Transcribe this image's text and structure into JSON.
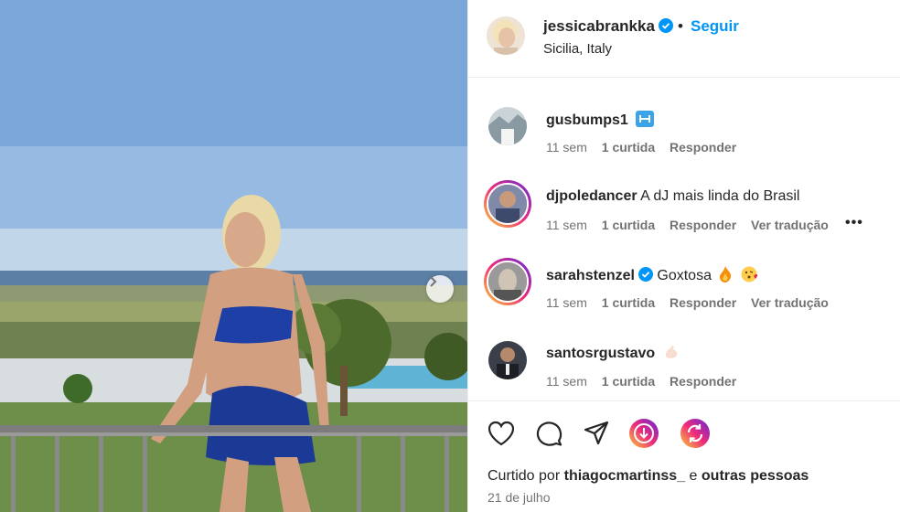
{
  "header": {
    "username": "jessicabrankka",
    "separator": "•",
    "follow_label": "Seguir",
    "location": "Sicilia, Italy"
  },
  "comments": [
    {
      "username": "gusbumps1",
      "text": "",
      "time": "11 sem",
      "likes": "1 curtida",
      "reply": "Responder",
      "translate": "",
      "emoji": "dumbbell-badge",
      "ring": false
    },
    {
      "username": "djpoledancer",
      "text": "A dJ mais linda do Brasil",
      "time": "11 sem",
      "likes": "1 curtida",
      "reply": "Responder",
      "translate": "Ver tradução",
      "ring": true
    },
    {
      "username": "sarahstenzel",
      "text": "Goxtosa",
      "time": "11 sem",
      "likes": "1 curtida",
      "reply": "Responder",
      "translate": "Ver tradução",
      "ring": true,
      "verified": true,
      "emoji": "fire-and-kiss"
    },
    {
      "username": "santosrgustavo",
      "text": "",
      "time": "11 sem",
      "likes": "1 curtida",
      "reply": "Responder",
      "translate": "",
      "emoji": "muscle",
      "ring": false
    }
  ],
  "more_options": "•••",
  "footer": {
    "liked_prefix": "Curtido por",
    "liked_user": "thiagocmartinss_",
    "liked_connector": "e",
    "liked_others": "outras pessoas",
    "date": "21 de julho"
  },
  "colors": {
    "accent": "#0095f6",
    "text": "#262626",
    "muted": "#737373",
    "divider": "#efefef"
  },
  "icons": [
    "heart-icon",
    "comment-icon",
    "share-icon",
    "reel-download-icon",
    "repost-icon",
    "next-arrow-icon",
    "verified-icon"
  ]
}
